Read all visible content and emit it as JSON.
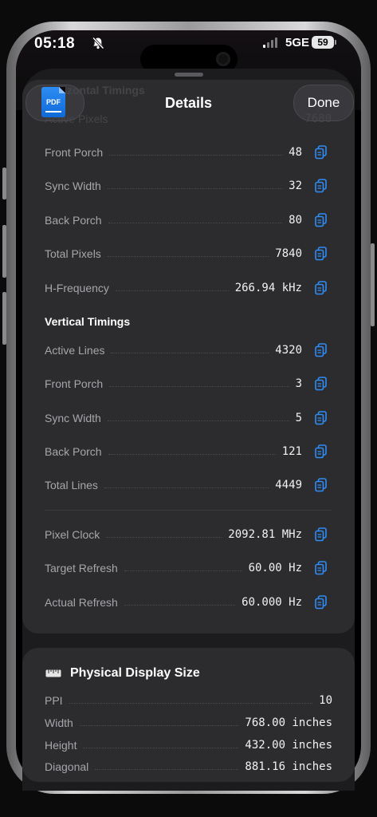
{
  "status": {
    "time": "05:18",
    "network": "5GE",
    "battery": "59"
  },
  "nav": {
    "title": "Details",
    "done_label": "Done",
    "pdf_label": "PDF"
  },
  "ghost": {
    "section": "Horizontal Timings",
    "label": "Active Pixels",
    "value": "7680"
  },
  "horizontal": [
    {
      "label": "Front Porch",
      "value": "48"
    },
    {
      "label": "Sync Width",
      "value": "32"
    },
    {
      "label": "Back Porch",
      "value": "80"
    },
    {
      "label": "Total Pixels",
      "value": "7840"
    },
    {
      "label": "H-Frequency",
      "value": "266.94 kHz"
    }
  ],
  "vertical": {
    "title": "Vertical Timings",
    "rows": [
      {
        "label": "Active Lines",
        "value": "4320"
      },
      {
        "label": "Front Porch",
        "value": "3"
      },
      {
        "label": "Sync Width",
        "value": "5"
      },
      {
        "label": "Back Porch",
        "value": "121"
      },
      {
        "label": "Total Lines",
        "value": "4449"
      }
    ]
  },
  "clock": [
    {
      "label": "Pixel Clock",
      "value": "2092.81 MHz"
    },
    {
      "label": "Target Refresh",
      "value": "60.00 Hz"
    },
    {
      "label": "Actual Refresh",
      "value": "60.000 Hz"
    }
  ],
  "physical": {
    "title": "Physical Display Size",
    "rows": [
      {
        "label": "PPI",
        "value": "10"
      },
      {
        "label": "Width",
        "value": "768.00 inches"
      },
      {
        "label": "Height",
        "value": "432.00 inches"
      },
      {
        "label": "Diagonal",
        "value": "881.16 inches"
      }
    ]
  },
  "colors": {
    "accent": "#2f8cf6",
    "sheet": "#1c1c1e",
    "card": "#2c2c2e"
  }
}
